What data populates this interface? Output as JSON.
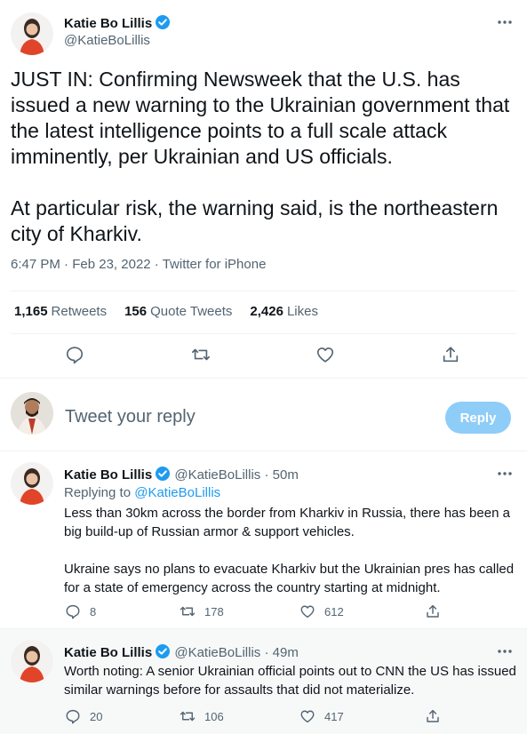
{
  "main_tweet": {
    "author_name": "Katie Bo Lillis",
    "author_handle": "@KatieBoLillis",
    "text": "JUST IN: Confirming Newsweek that the U.S. has issued a new warning to the Ukrainian government that the latest intelligence points to a full scale attack imminently, per Ukrainian and US officials.\n\nAt particular risk, the warning said, is the northeastern city of Kharkiv.",
    "time": "6:47 PM",
    "date": "Feb 23, 2022",
    "source": "Twitter for iPhone",
    "sep": "·",
    "stats": {
      "retweets_count": "1,165",
      "retweets_label": "Retweets",
      "quotes_count": "156",
      "quotes_label": "Quote Tweets",
      "likes_count": "2,426",
      "likes_label": "Likes"
    }
  },
  "reply_box": {
    "placeholder": "Tweet your reply",
    "button_label": "Reply"
  },
  "replies": [
    {
      "author_name": "Katie Bo Lillis",
      "author_handle": "@KatieBoLillis",
      "time_ago": "· 50m",
      "replying_label": "Replying to",
      "replying_to": "@KatieBoLillis",
      "text": "Less than 30km across the border from Kharkiv in Russia, there has been a big build-up of Russian armor & support vehicles.\n\nUkraine says no plans to evacuate Kharkiv but the Ukrainian pres has called for a state of emergency across the country starting at midnight.",
      "replies_count": "8",
      "retweets_count": "178",
      "likes_count": "612"
    },
    {
      "author_name": "Katie Bo Lillis",
      "author_handle": "@KatieBoLillis",
      "time_ago": "· 49m",
      "text": "Worth noting: A senior Ukrainian official points out to CNN the US has issued similar warnings before for assaults that did not materialize.",
      "replies_count": "20",
      "retweets_count": "106",
      "likes_count": "417"
    }
  ],
  "colors": {
    "accent": "#1d9bf0",
    "text": "#0f1419",
    "muted": "#536471",
    "reply_button": "#8ecdf8",
    "divider": "#eff3f4",
    "avatar_dress": "#e0452a"
  },
  "icons": [
    "verified-badge-icon",
    "more-icon",
    "reply-icon",
    "retweet-icon",
    "like-icon",
    "share-icon"
  ]
}
